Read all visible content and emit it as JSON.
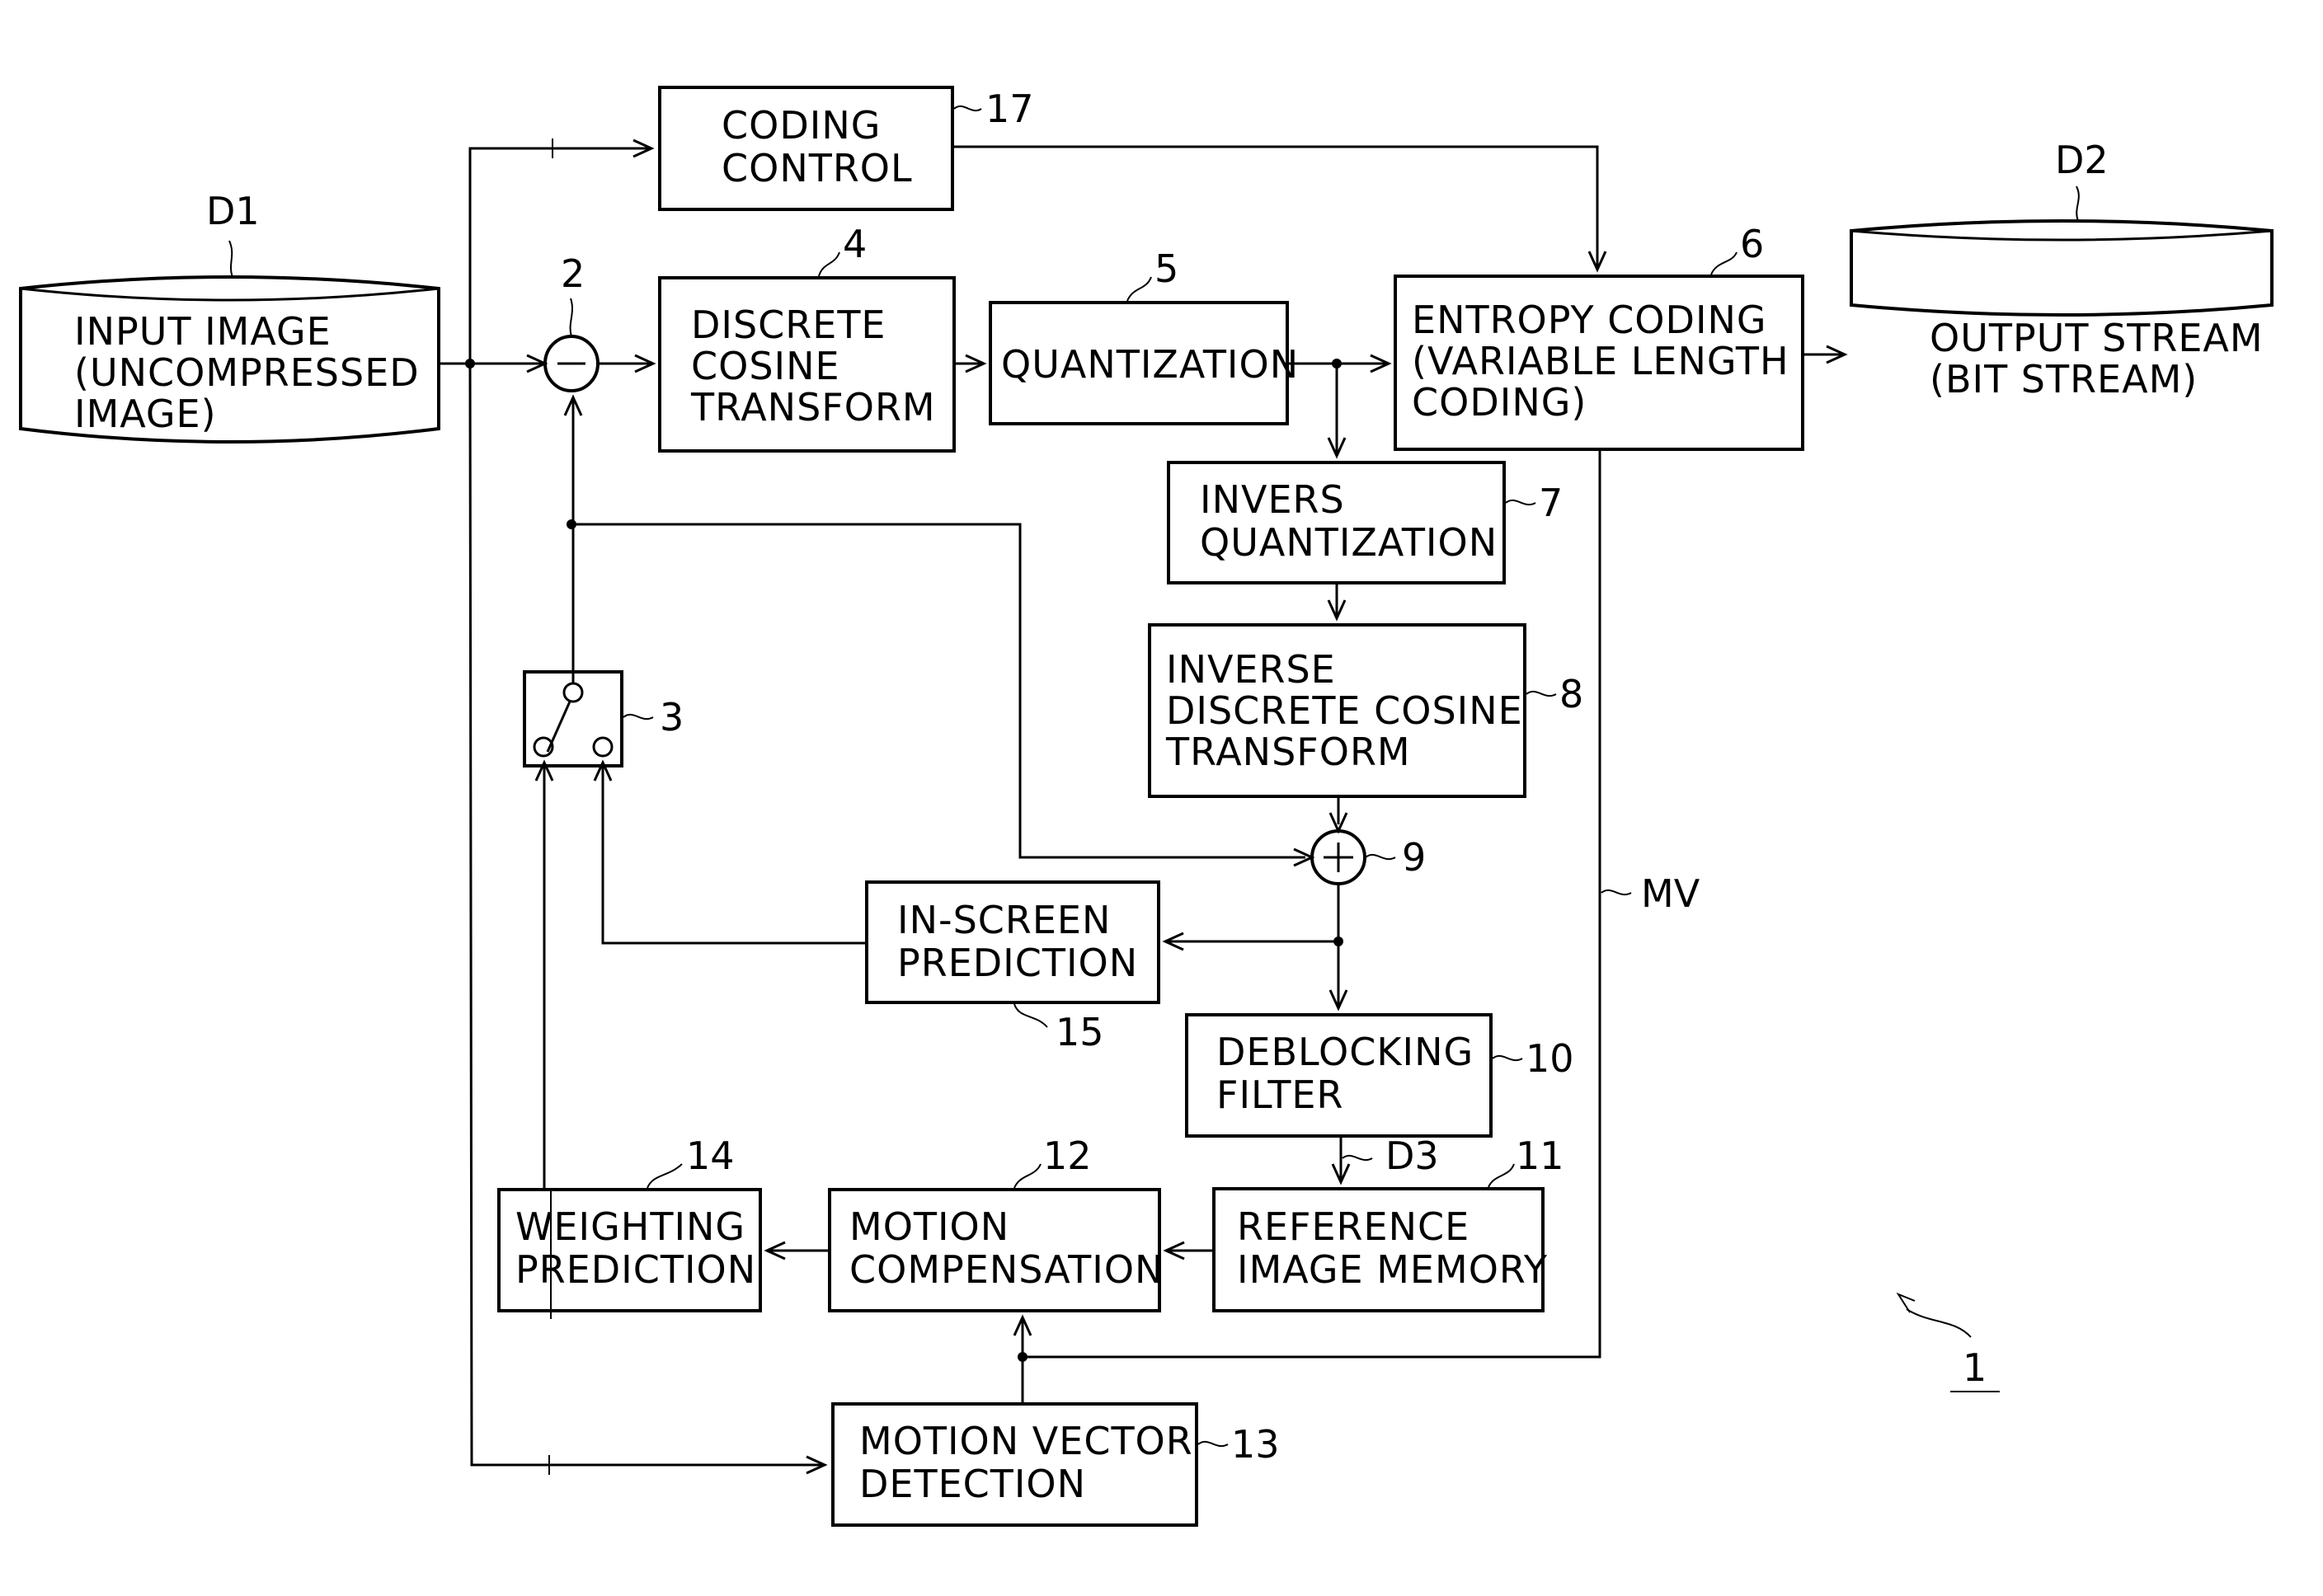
{
  "figure": {
    "reference_number": "1",
    "blocks": [
      {
        "id": "coding-control",
        "ref": "17",
        "lines": [
          "CODING",
          "CONTROL"
        ]
      },
      {
        "id": "dct",
        "ref": "4",
        "lines": [
          "DISCRETE",
          "COSINE",
          "TRANSFORM"
        ]
      },
      {
        "id": "quantization",
        "ref": "5",
        "lines": [
          "QUANTIZATION"
        ]
      },
      {
        "id": "entropy-coding",
        "ref": "6",
        "lines": [
          "ENTROPY CODING",
          "(VARIABLE LENGTH",
          "CODING)"
        ]
      },
      {
        "id": "inverse-quantization",
        "ref": "7",
        "lines": [
          "INVERS",
          "QUANTIZATION"
        ]
      },
      {
        "id": "idct",
        "ref": "8",
        "lines": [
          "INVERSE",
          "DISCRETE COSINE",
          "TRANSFORM"
        ]
      },
      {
        "id": "in-screen-prediction",
        "ref": "15",
        "lines": [
          "IN-SCREEN",
          "PREDICTION"
        ]
      },
      {
        "id": "deblocking-filter",
        "ref": "10",
        "lines": [
          "DEBLOCKING",
          "FILTER"
        ]
      },
      {
        "id": "reference-image-memory",
        "ref": "11",
        "lines": [
          "REFERENCE",
          "IMAGE MEMORY"
        ]
      },
      {
        "id": "motion-compensation",
        "ref": "12",
        "lines": [
          "MOTION",
          "COMPENSATION"
        ]
      },
      {
        "id": "weighting-prediction",
        "ref": "14",
        "lines": [
          "WEIGHTING",
          "PREDICTION"
        ]
      },
      {
        "id": "motion-vector-detection",
        "ref": "13",
        "lines": [
          "MOTION VECTOR",
          "DETECTION"
        ]
      }
    ],
    "storages": [
      {
        "id": "input-image",
        "ref": "D1",
        "lines": [
          "INPUT IMAGE",
          "(UNCOMPRESSED",
          "IMAGE)"
        ]
      },
      {
        "id": "output-stream",
        "ref": "D2",
        "lines": [
          "OUTPUT STREAM",
          "(BIT STREAM)"
        ]
      }
    ],
    "operators": [
      {
        "id": "subtractor",
        "ref": "2",
        "symbol": "−"
      },
      {
        "id": "adder",
        "ref": "9",
        "symbol": "+"
      }
    ],
    "switch": {
      "ref": "3"
    },
    "signal_labels": {
      "motion_vector": "MV",
      "decoded_image": "D3"
    }
  }
}
